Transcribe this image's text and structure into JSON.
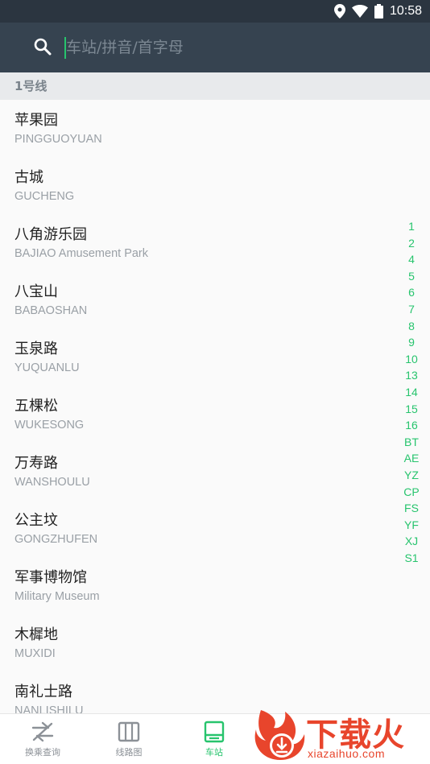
{
  "status_bar": {
    "time": "10:58"
  },
  "search": {
    "placeholder": "车站/拼音/首字母",
    "value": ""
  },
  "section": {
    "title": "1号线"
  },
  "stations": [
    {
      "name": "苹果园",
      "pinyin": "PINGGUOYUAN"
    },
    {
      "name": "古城",
      "pinyin": "GUCHENG"
    },
    {
      "name": "八角游乐园",
      "pinyin": "BAJIAO Amusement Park"
    },
    {
      "name": "八宝山",
      "pinyin": "BABAOSHAN"
    },
    {
      "name": "玉泉路",
      "pinyin": "YUQUANLU"
    },
    {
      "name": "五棵松",
      "pinyin": "WUKESONG"
    },
    {
      "name": "万寿路",
      "pinyin": "WANSHOULU"
    },
    {
      "name": "公主坟",
      "pinyin": "GONGZHUFEN"
    },
    {
      "name": "军事博物馆",
      "pinyin": "Military Museum"
    },
    {
      "name": "木樨地",
      "pinyin": "MUXIDI"
    },
    {
      "name": "南礼士路",
      "pinyin": "NANLISHILU"
    }
  ],
  "line_index": [
    "1",
    "2",
    "4",
    "5",
    "6",
    "7",
    "8",
    "9",
    "10",
    "13",
    "14",
    "15",
    "16",
    "BT",
    "AE",
    "YZ",
    "CP",
    "FS",
    "YF",
    "XJ",
    "S1"
  ],
  "bottom_nav": {
    "transfer": "换乘查询",
    "map": "线路图",
    "stations": "车站"
  },
  "watermark": {
    "brand": "下载火",
    "domain": "xiazaihuo.com"
  },
  "colors": {
    "accent": "#27c46d",
    "header": "#364350",
    "status": "#2b3540",
    "brand": "#e8452c"
  }
}
